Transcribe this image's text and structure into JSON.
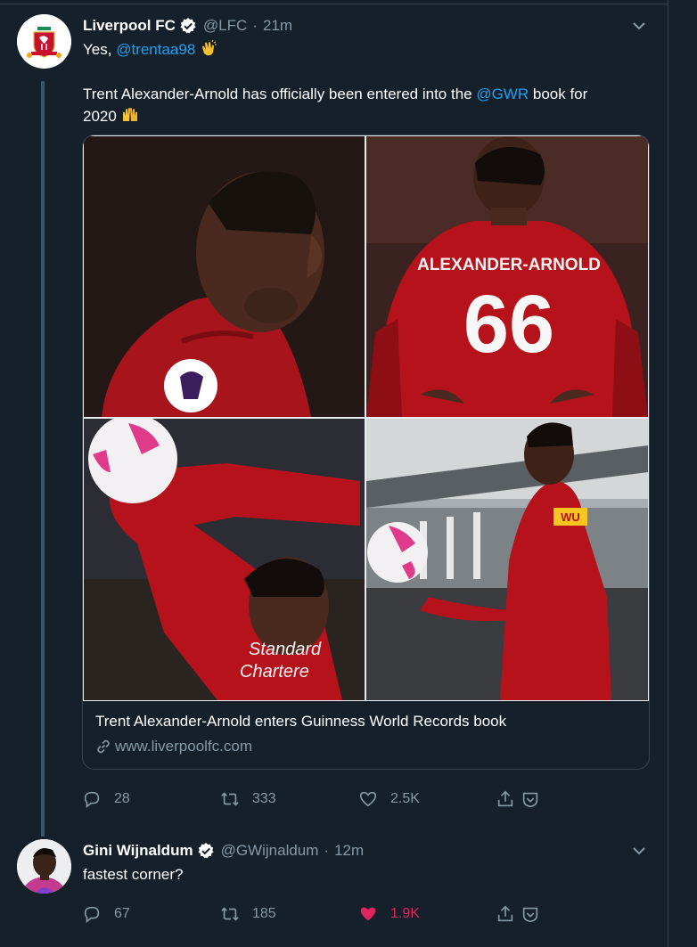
{
  "tweets": [
    {
      "author": {
        "name": "Liverpool FC",
        "handle": "@LFC",
        "time": "21m",
        "verified": true
      },
      "text": {
        "line1_prefix": "Yes, ",
        "line1_mention": "@trentaa98",
        "line1_emoji": "clapping-hands-emoji",
        "line2_prefix": "Trent Alexander-Arnold has officially been entered into the ",
        "line2_mention": "@GWR",
        "line2_suffix": " book for",
        "line3": "2020",
        "line3_emoji": "raising-hands-emoji"
      },
      "card": {
        "title": "Trent Alexander-Arnold enters Guinness World Records book",
        "domain": "www.liverpoolfc.com",
        "photos": [
          {
            "name": "profile-photo",
            "sleeve_text": ""
          },
          {
            "name": "back-shirt-photo",
            "shirt_name": "ALEXANDER-ARNOLD",
            "shirt_number": "66"
          },
          {
            "name": "throw-in-photo",
            "sponsor_line1": "Standard",
            "sponsor_line2": "Chartere"
          },
          {
            "name": "stadium-ball-photo",
            "sponsor": "WU"
          }
        ]
      },
      "actions": {
        "replies": "28",
        "retweets": "333",
        "likes": "2.5K",
        "liked": false
      }
    },
    {
      "author": {
        "name": "Gini Wijnaldum",
        "handle": "@GWijnaldum",
        "time": "12m",
        "verified": true
      },
      "text": {
        "line1": "fastest corner?"
      },
      "actions": {
        "replies": "67",
        "retweets": "185",
        "likes": "1.9K",
        "liked": true
      }
    }
  ],
  "colors": {
    "background": "#15202b",
    "secondary_text": "#8899a6",
    "link": "#1da1f2",
    "like_active": "#e0245e",
    "border": "#38444d",
    "lfc_red": "#c8102e"
  }
}
